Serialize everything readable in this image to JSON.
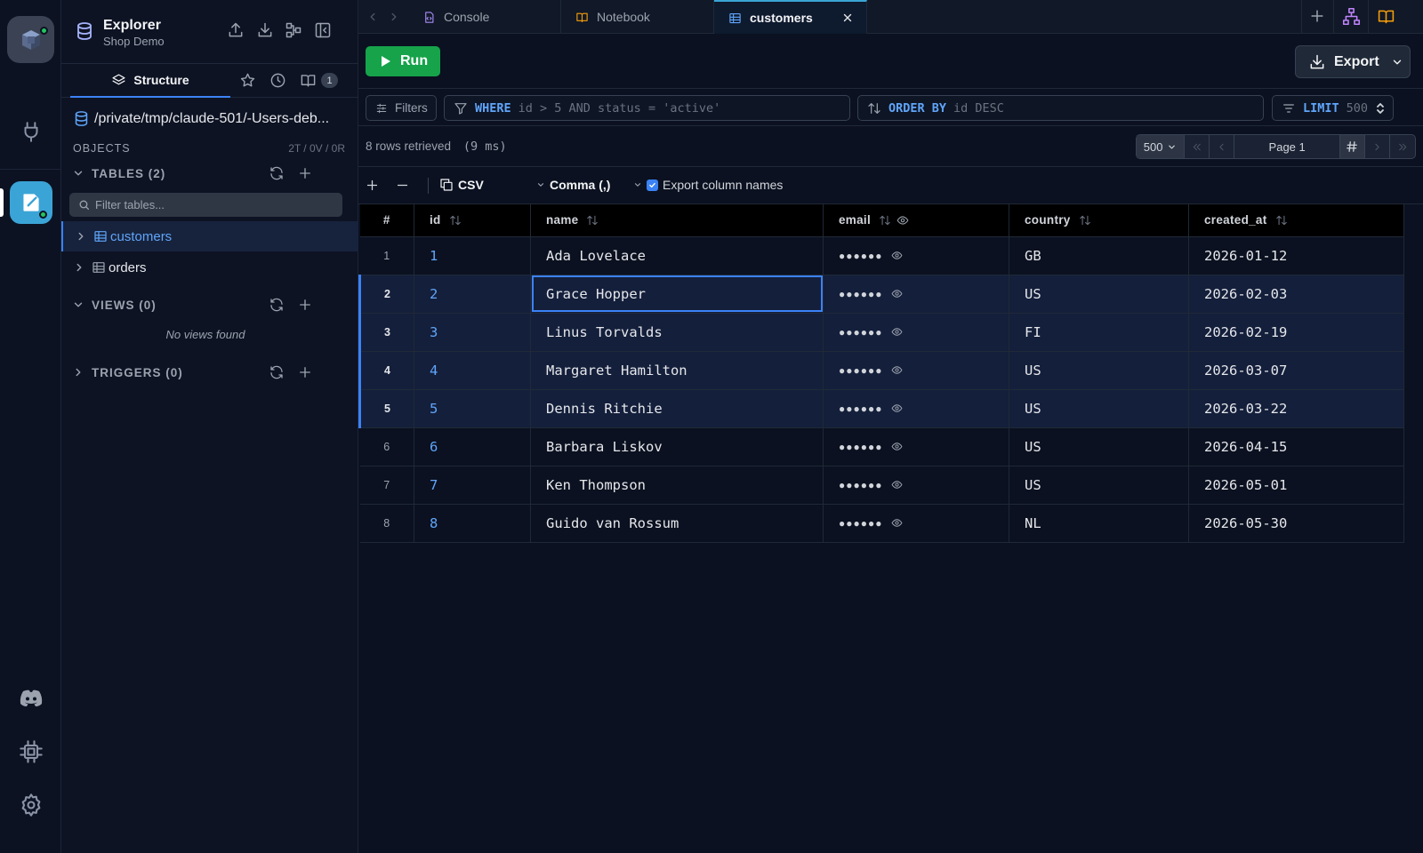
{
  "app": {
    "explorer_title": "Explorer",
    "database_name": "Shop Demo",
    "accent_color": "#3ba4d6"
  },
  "sidebar": {
    "tabs": {
      "structure_label": "Structure",
      "notebook_badge": "1"
    },
    "path": "/private/tmp/claude-501/-Users-deb...",
    "objects_label": "OBJECTS",
    "object_counts": "2T / 0V / 0R",
    "tables_section": "TABLES (2)",
    "filter_placeholder": "Filter tables...",
    "tables": [
      {
        "name": "customers",
        "active": true
      },
      {
        "name": "orders",
        "active": false
      }
    ],
    "views_section": "VIEWS (0)",
    "no_views": "No views found",
    "triggers_section": "TRIGGERS (0)"
  },
  "tabs": [
    {
      "label": "Console",
      "icon": "file-code-icon"
    },
    {
      "label": "Notebook",
      "icon": "book-icon"
    },
    {
      "label": "customers",
      "icon": "table-icon",
      "active": true
    }
  ],
  "toolbar": {
    "run_label": "Run",
    "export_label": "Export"
  },
  "query": {
    "filters_label": "Filters",
    "where_keyword": "WHERE",
    "where_placeholder": "id > 5 AND status = 'active'",
    "order_keyword": "ORDER BY",
    "order_placeholder": "id DESC",
    "limit_keyword": "LIMIT",
    "limit_placeholder": "500"
  },
  "results": {
    "rows_retrieved": "8 rows retrieved",
    "timing": "(9 ms)",
    "page_size": "500",
    "page_label": "Page 1"
  },
  "grid_toolbar": {
    "format_label": "CSV",
    "delimiter_label": "Comma (,)",
    "export_names_label": "Export column names",
    "export_names_checked": true
  },
  "table": {
    "columns": [
      "#",
      "id",
      "name",
      "email",
      "country",
      "created_at"
    ],
    "masked_value": "●●●●●●",
    "rows": [
      {
        "rn": "1",
        "id": "1",
        "name": "Ada Lovelace",
        "country": "GB",
        "created_at": "2026-01-12"
      },
      {
        "rn": "2",
        "id": "2",
        "name": "Grace Hopper",
        "country": "US",
        "created_at": "2026-02-03"
      },
      {
        "rn": "3",
        "id": "3",
        "name": "Linus Torvalds",
        "country": "FI",
        "created_at": "2026-02-19"
      },
      {
        "rn": "4",
        "id": "4",
        "name": "Margaret Hamilton",
        "country": "US",
        "created_at": "2026-03-07"
      },
      {
        "rn": "5",
        "id": "5",
        "name": "Dennis Ritchie",
        "country": "US",
        "created_at": "2026-03-22"
      },
      {
        "rn": "6",
        "id": "6",
        "name": "Barbara Liskov",
        "country": "US",
        "created_at": "2026-04-15"
      },
      {
        "rn": "7",
        "id": "7",
        "name": "Ken Thompson",
        "country": "US",
        "created_at": "2026-05-01"
      },
      {
        "rn": "8",
        "id": "8",
        "name": "Guido van Rossum",
        "country": "NL",
        "created_at": "2026-05-30"
      }
    ],
    "selected_rows": [
      "2",
      "3",
      "4",
      "5"
    ],
    "focused_cell": {
      "row": "2",
      "column": "name"
    }
  }
}
